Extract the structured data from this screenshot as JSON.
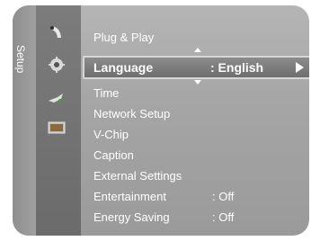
{
  "sidebar": {
    "section_label": "Setup",
    "icons": [
      "satellite-dish-icon",
      "gear-icon",
      "input-plug-icon",
      "screen-icon"
    ]
  },
  "menu": {
    "items": [
      {
        "label": "Plug & Play",
        "value": ""
      },
      {
        "label": "Language",
        "value": ": English",
        "selected": true
      },
      {
        "label": "Time",
        "value": ""
      },
      {
        "label": "Network Setup",
        "value": ""
      },
      {
        "label": "V-Chip",
        "value": ""
      },
      {
        "label": "Caption",
        "value": ""
      },
      {
        "label": "External Settings",
        "value": ""
      },
      {
        "label": "Entertainment",
        "value": ": Off"
      },
      {
        "label": "Energy Saving",
        "value": ": Off"
      }
    ]
  },
  "colors": {
    "panel_bg": "#a6a6a6",
    "icon_column_bg": "#6b6b6b",
    "text": "#ffffff",
    "highlight_border": "#d6d6d6"
  }
}
